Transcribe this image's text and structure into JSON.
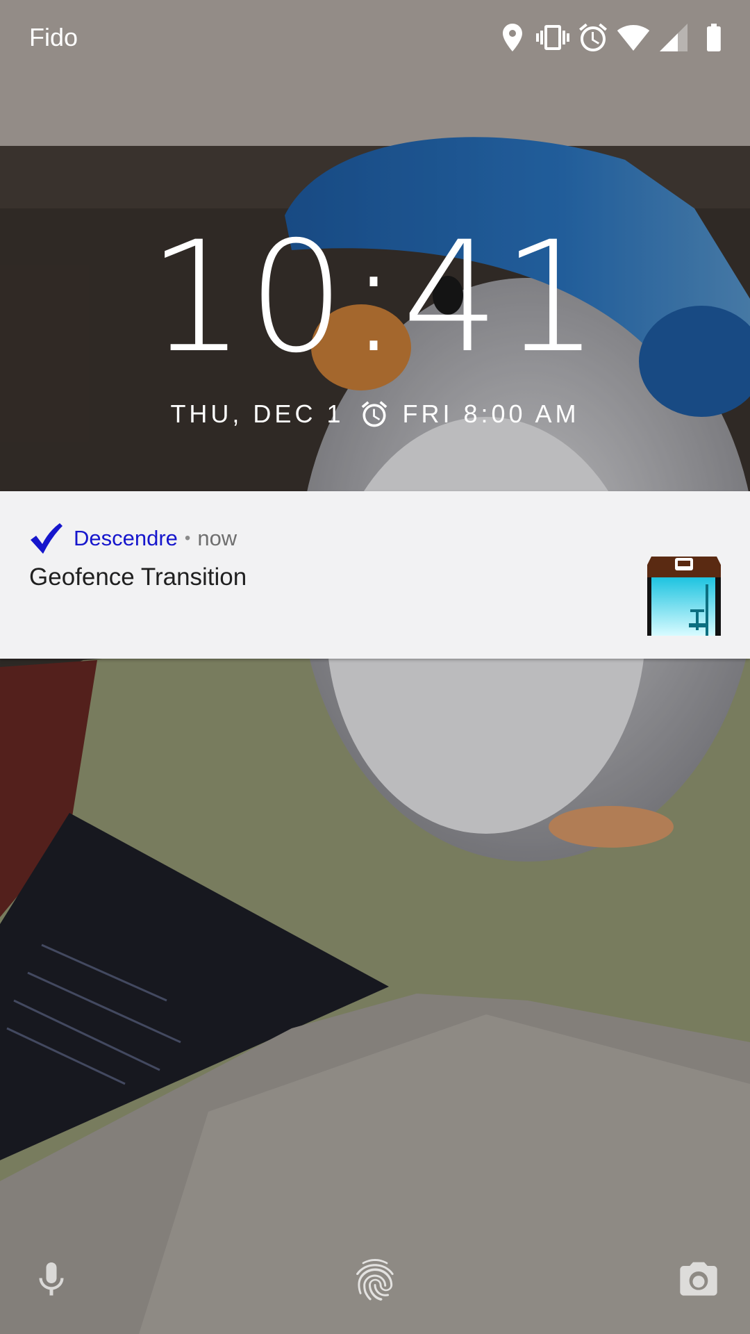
{
  "status_bar": {
    "carrier": "Fido",
    "icons": [
      "location-icon",
      "vibrate-icon",
      "alarm-icon",
      "wifi-icon",
      "cell-signal-icon",
      "battery-icon"
    ]
  },
  "lockscreen": {
    "time": "10:41",
    "date": "THU, DEC 1",
    "next_alarm": "FRI 8:00 AM"
  },
  "notification": {
    "app_name": "Descendre",
    "separator": "•",
    "time": "now",
    "title": "Geofence Transition",
    "app_icon": "checkmark-icon",
    "app_color": "#1616cc",
    "thumbnail": "elevator-icon"
  },
  "bottom_bar": {
    "icons": [
      "microphone-icon",
      "fingerprint-icon",
      "camera-icon"
    ]
  }
}
